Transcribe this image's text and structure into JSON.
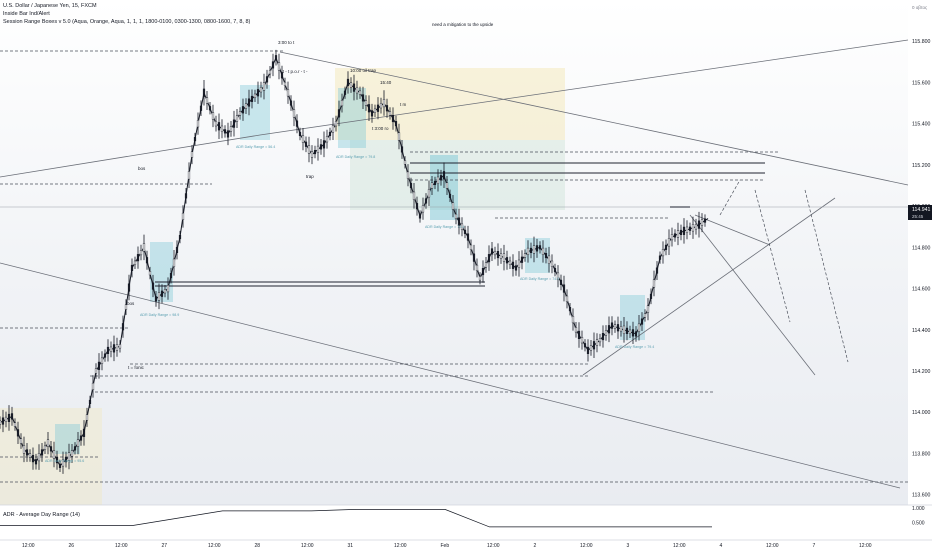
{
  "header": {
    "symbol_line": "U.S. Dollar / Japanese Yen, 15, FXCM",
    "indicator_1": "Inside Bar Ind/Alert",
    "indicator_2": "Session Range Boxes v 5.0 (Aqua, Orange, Aqua, 1, 1, 1, 1800-0100, 0300-1300, 0800-1600, 7, 8, 8)",
    "note": "need a mitigation to the upside",
    "corner_label": "0 οβτος"
  },
  "annotations": {
    "top_high": "3:00 to t",
    "mid_a": "- t - t p.o.r - t - ",
    "mid_b": "10:00 oil trap",
    "mid_c": "15:40",
    "mid_d": "t 3:00 ro",
    "mid_e": "t m",
    "bos": "bos",
    "trap": "trap",
    "left_low": "t = fonic",
    "left_mid": "bos"
  },
  "adr_labels": [
    "ADR Daily Range = 95.6",
    "ADR Daily Range = 98.9",
    "ADR Daily Range = 56.4",
    "ADR Daily Range = 79.8",
    "ADR Daily Range = 73.4",
    "ADR Daily Range = 74.9",
    "ADR Daily Range = 79.4"
  ],
  "chart_data": {
    "type": "line",
    "title": "U.S. Dollar / Japanese Yen, 15, FXCM",
    "y_axis": {
      "range": [
        113.55,
        116.0
      ],
      "ticks": [
        "115.800",
        "115.600",
        "115.400",
        "115.200",
        "115.000",
        "114.800",
        "114.600",
        "114.400",
        "114.200",
        "114.000",
        "113.800",
        "113.600"
      ],
      "current_price": "114.941",
      "current_sub": "25:45",
      "side": "right"
    },
    "x_axis": {
      "ticks": [
        "12:00",
        "26",
        "12:00",
        "27",
        "12:00",
        "28",
        "12:00",
        "31",
        "12:00",
        "Feb",
        "12:00",
        "2",
        "12:00",
        "3",
        "12:00",
        "4",
        "12:00",
        "7",
        "12:00"
      ]
    },
    "price_path": [
      [
        0,
        113.95
      ],
      [
        12,
        113.98
      ],
      [
        24,
        113.82
      ],
      [
        36,
        113.76
      ],
      [
        48,
        113.85
      ],
      [
        60,
        113.74
      ],
      [
        72,
        113.8
      ],
      [
        84,
        113.9
      ],
      [
        96,
        114.2
      ],
      [
        108,
        114.3
      ],
      [
        120,
        114.32
      ],
      [
        132,
        114.7
      ],
      [
        144,
        114.8
      ],
      [
        156,
        114.55
      ],
      [
        168,
        114.6
      ],
      [
        180,
        114.85
      ],
      [
        192,
        115.25
      ],
      [
        204,
        115.55
      ],
      [
        216,
        115.4
      ],
      [
        228,
        115.35
      ],
      [
        240,
        115.45
      ],
      [
        252,
        115.52
      ],
      [
        264,
        115.58
      ],
      [
        276,
        115.72
      ],
      [
        288,
        115.55
      ],
      [
        300,
        115.35
      ],
      [
        312,
        115.25
      ],
      [
        324,
        115.3
      ],
      [
        336,
        115.4
      ],
      [
        348,
        115.6
      ],
      [
        360,
        115.55
      ],
      [
        372,
        115.45
      ],
      [
        384,
        115.5
      ],
      [
        396,
        115.4
      ],
      [
        408,
        115.15
      ],
      [
        420,
        114.95
      ],
      [
        432,
        115.1
      ],
      [
        444,
        115.15
      ],
      [
        456,
        114.95
      ],
      [
        468,
        114.85
      ],
      [
        480,
        114.65
      ],
      [
        492,
        114.78
      ],
      [
        504,
        114.75
      ],
      [
        516,
        114.7
      ],
      [
        528,
        114.78
      ],
      [
        540,
        114.8
      ],
      [
        552,
        114.72
      ],
      [
        564,
        114.6
      ],
      [
        576,
        114.4
      ],
      [
        588,
        114.3
      ],
      [
        600,
        114.35
      ],
      [
        612,
        114.42
      ],
      [
        624,
        114.4
      ],
      [
        636,
        114.38
      ],
      [
        648,
        114.5
      ],
      [
        660,
        114.75
      ],
      [
        672,
        114.85
      ],
      [
        684,
        114.88
      ],
      [
        696,
        114.9
      ],
      [
        708,
        114.94
      ]
    ],
    "adr_indicator": {
      "title": "ADR - Average Day Range (14)",
      "ticks": [
        "1.000",
        "0.500"
      ],
      "values": [
        0.4,
        0.4,
        0.4,
        0.4,
        0.65,
        0.9,
        0.9,
        0.9,
        0.95,
        0.95,
        0.95,
        0.35,
        0.35,
        0.35,
        0.35,
        0.35,
        0.35
      ]
    },
    "grid": true,
    "legend": "top-left"
  },
  "colors": {
    "candle": "#131722",
    "session_aqua": "#7ec8d6",
    "session_orange": "#f3e7b8",
    "axis_text": "#131722",
    "price_label_bg": "#131722"
  }
}
